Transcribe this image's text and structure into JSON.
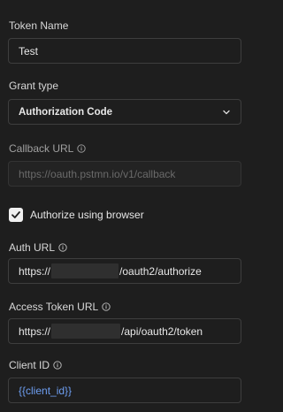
{
  "token_name": {
    "label": "Token Name",
    "value": "Test"
  },
  "grant_type": {
    "label": "Grant type",
    "selected": "Authorization Code"
  },
  "callback_url": {
    "label": "Callback URL",
    "placeholder": "https://oauth.pstmn.io/v1/callback"
  },
  "authorize_browser": {
    "label": "Authorize using browser",
    "checked": true
  },
  "auth_url": {
    "label": "Auth URL",
    "prefix": "https://",
    "suffix": "/oauth2/authorize"
  },
  "access_token_url": {
    "label": "Access Token URL",
    "prefix": "https://",
    "suffix": "/api/oauth2/token"
  },
  "client_id": {
    "label": "Client ID",
    "value": "{{client_id}}"
  },
  "colors": {
    "background": "#1e1e1e",
    "variable": "#6e9ff2",
    "border": "#3e3e3e"
  },
  "icons": [
    "info-icon",
    "chevron-down-icon",
    "checkmark-icon"
  ]
}
